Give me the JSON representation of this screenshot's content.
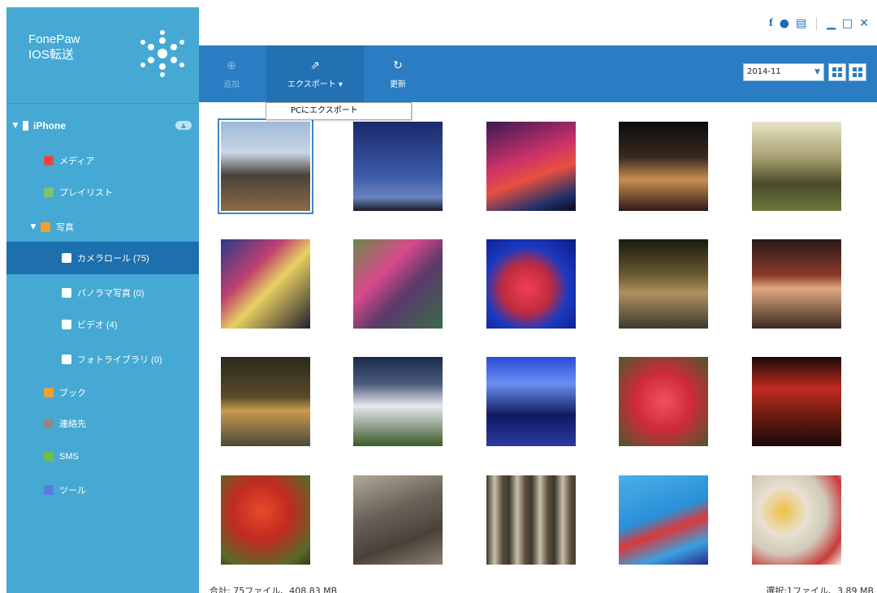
{
  "app": {
    "name_line1": "FonePaw",
    "name_line2": "IOS転送"
  },
  "window_controls": [
    "facebook-icon",
    "feedback-icon",
    "register-icon",
    "minimize-icon",
    "maximize-icon",
    "close-icon"
  ],
  "sidebar": {
    "device": {
      "label": "iPhone",
      "icon": "phone-icon"
    },
    "items": [
      {
        "label": "メディア",
        "icon": "music-icon",
        "color": "#e8483f"
      },
      {
        "label": "プレイリスト",
        "icon": "playlist-icon",
        "color": "#7dc36b"
      },
      {
        "label": "写真",
        "icon": "photos-icon",
        "color": "#f0a030"
      },
      {
        "label": "カメラロール (75)",
        "icon": "camera-icon",
        "color": "#ffffff"
      },
      {
        "label": "パノラマ写真 (0)",
        "icon": "camera-icon",
        "color": "#ffffff"
      },
      {
        "label": "ビデオ (4)",
        "icon": "camera-icon",
        "color": "#ffffff"
      },
      {
        "label": "フォトライブラリ (0)",
        "icon": "photo-library-icon",
        "color": "#ffffff"
      },
      {
        "label": "ブック",
        "icon": "book-icon",
        "color": "#f0a030"
      },
      {
        "label": "連絡先",
        "icon": "contacts-icon",
        "color": "#8a8a8a"
      },
      {
        "label": "SMS",
        "icon": "sms-icon",
        "color": "#6cc04a"
      },
      {
        "label": "ツール",
        "icon": "tools-icon",
        "color": "#5a7de0"
      }
    ]
  },
  "toolbar": {
    "add_label": "追加",
    "export_label": "エクスポート ▾",
    "refresh_label": "更新",
    "date_value": "2014-11"
  },
  "export_menu": {
    "item": "PCにエクスポート"
  },
  "status": {
    "left": "合計: 75ファイル、408.83 MB",
    "right": "選択:1ファイル、3.89 MB"
  },
  "colors": {
    "sidebar": "#45a9d3",
    "sidebar_selected": "#1d6fad",
    "toolbar": "#2a7dc2"
  }
}
